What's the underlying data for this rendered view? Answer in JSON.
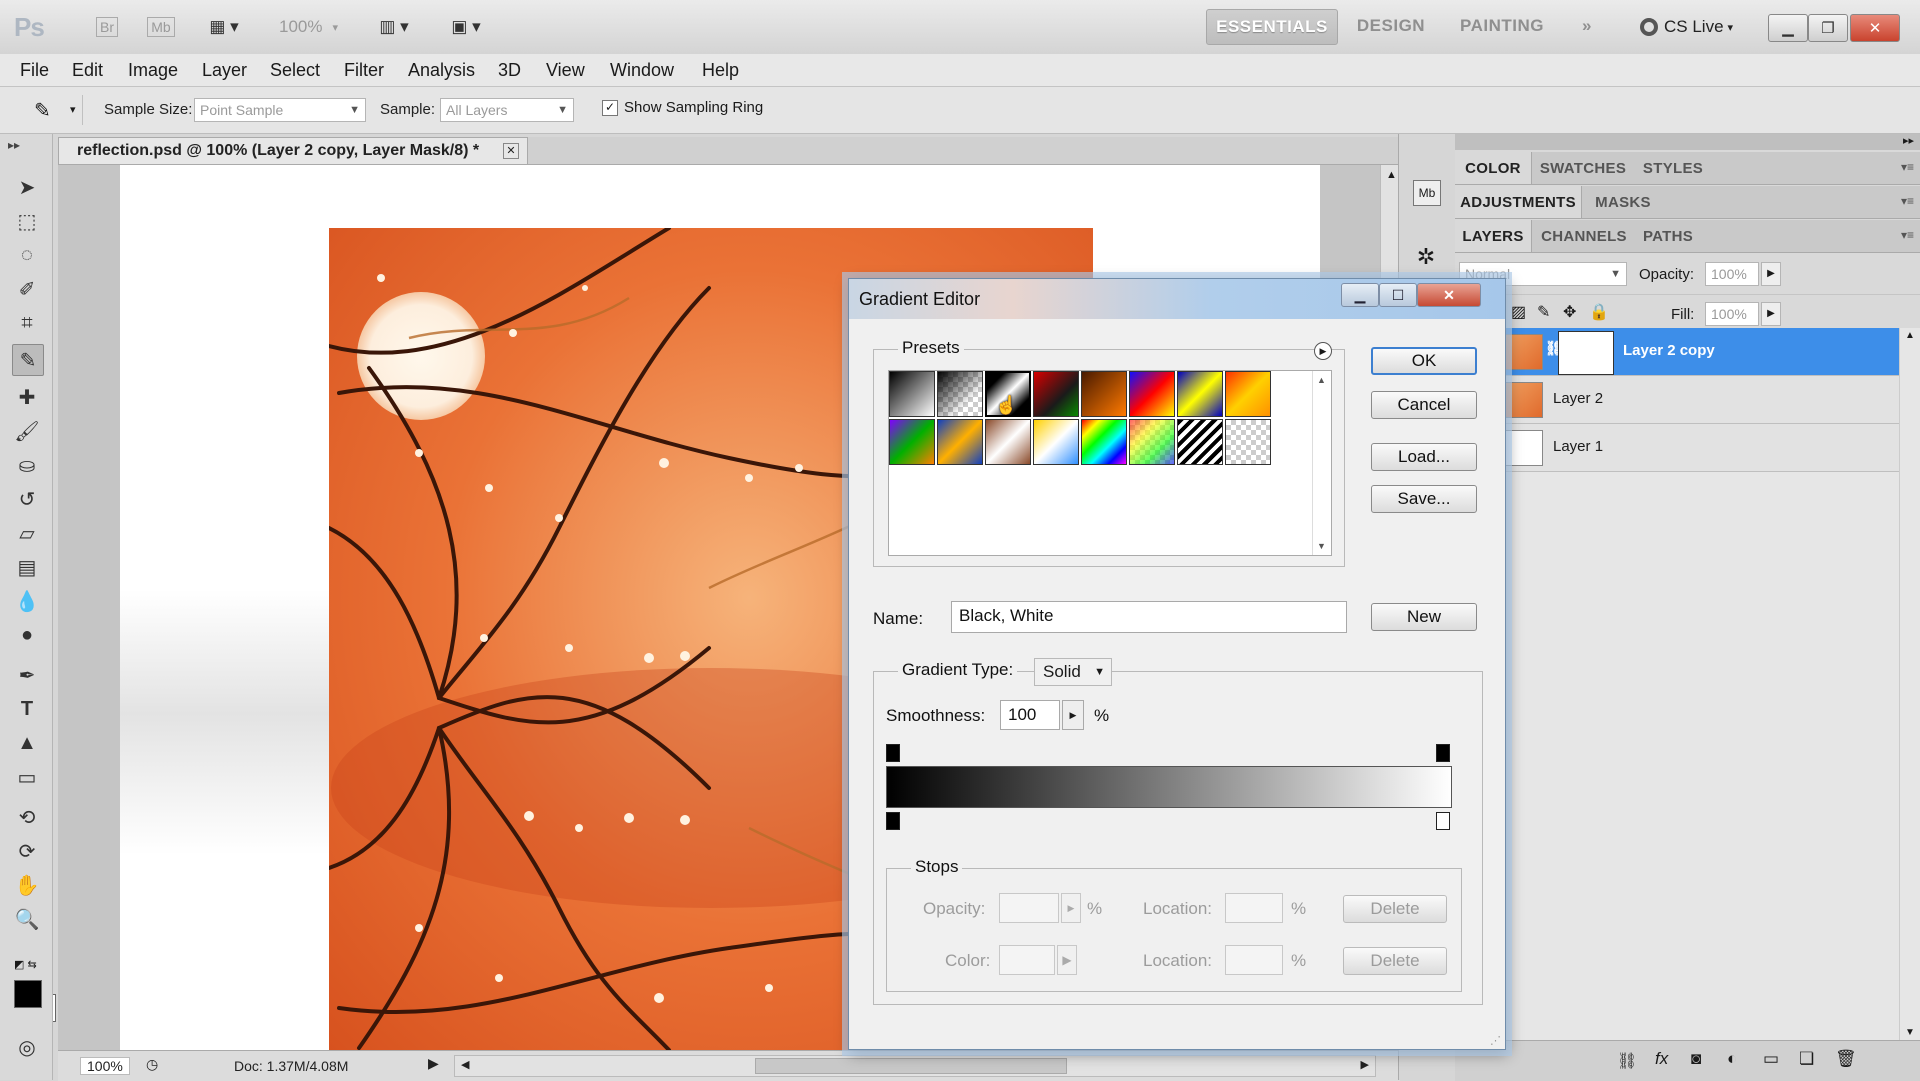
{
  "app": {
    "logo": "Ps",
    "bridge": "Br",
    "minibridge": "Mb",
    "zoom": "100%",
    "workspaces": [
      "ESSENTIALS",
      "DESIGN",
      "PAINTING"
    ],
    "cs_live": "CS Live"
  },
  "menu": [
    "File",
    "Edit",
    "Image",
    "Layer",
    "Select",
    "Filter",
    "Analysis",
    "3D",
    "View",
    "Window",
    "Help"
  ],
  "options": {
    "sample_size_label": "Sample Size:",
    "sample_size_value": "Point Sample",
    "sample_label": "Sample:",
    "sample_value": "All Layers",
    "show_ring_label": "Show Sampling Ring",
    "show_ring_checked": true
  },
  "document": {
    "tab_title": "reflection.psd @ 100% (Layer 2 copy, Layer Mask/8) *",
    "status_zoom": "100%",
    "status_doc": "Doc: 1.37M/4.08M"
  },
  "panels": {
    "group1": [
      "COLOR",
      "SWATCHES",
      "STYLES"
    ],
    "group2": [
      "ADJUSTMENTS",
      "MASKS"
    ],
    "group3": [
      "LAYERS",
      "CHANNELS",
      "PATHS"
    ],
    "blend_mode": "Normal",
    "opacity_label": "Opacity:",
    "opacity_value": "100%",
    "fill_label": "Fill:",
    "fill_value": "100%",
    "layers": [
      {
        "name": "Layer 2 copy",
        "selected": true
      },
      {
        "name": "Layer 2",
        "selected": false
      },
      {
        "name": "Layer 1",
        "selected": false
      }
    ]
  },
  "dialog": {
    "title": "Gradient Editor",
    "presets_label": "Presets",
    "ok": "OK",
    "cancel": "Cancel",
    "load": "Load...",
    "save": "Save...",
    "name_label": "Name:",
    "name_value": "Black, White",
    "new": "New",
    "gradient_type_label": "Gradient Type:",
    "gradient_type_value": "Solid",
    "smoothness_label": "Smoothness:",
    "smoothness_value": "100",
    "percent": "%",
    "stops_label": "Stops",
    "opacity_label": "Opacity:",
    "color_label": "Color:",
    "location_label": "Location:",
    "delete": "Delete"
  },
  "colors": {
    "accent": "#3d8ee9",
    "photo_orange": "#e8632a"
  }
}
